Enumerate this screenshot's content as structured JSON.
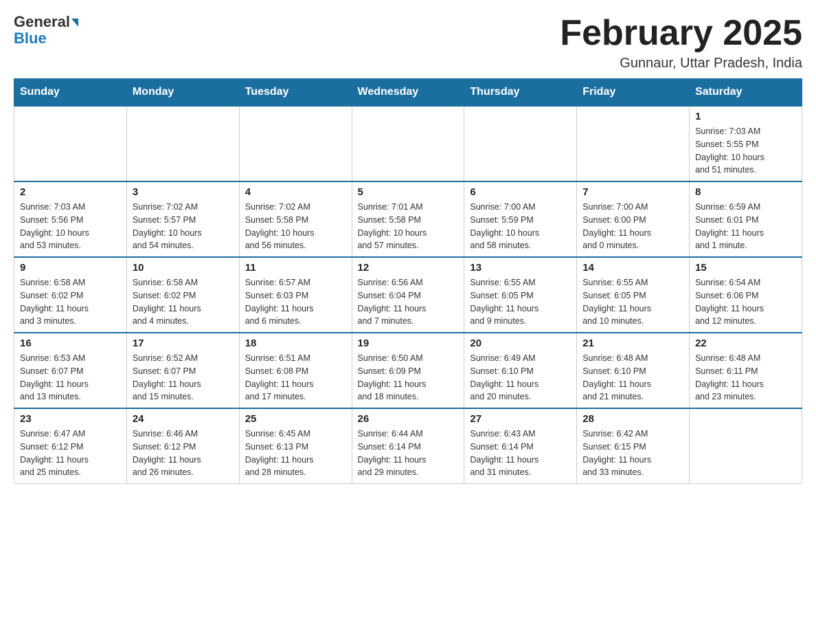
{
  "header": {
    "logo_general": "General",
    "logo_blue": "Blue",
    "month_title": "February 2025",
    "location": "Gunnaur, Uttar Pradesh, India"
  },
  "weekdays": [
    "Sunday",
    "Monday",
    "Tuesday",
    "Wednesday",
    "Thursday",
    "Friday",
    "Saturday"
  ],
  "weeks": [
    [
      {
        "day": "",
        "info": ""
      },
      {
        "day": "",
        "info": ""
      },
      {
        "day": "",
        "info": ""
      },
      {
        "day": "",
        "info": ""
      },
      {
        "day": "",
        "info": ""
      },
      {
        "day": "",
        "info": ""
      },
      {
        "day": "1",
        "info": "Sunrise: 7:03 AM\nSunset: 5:55 PM\nDaylight: 10 hours\nand 51 minutes."
      }
    ],
    [
      {
        "day": "2",
        "info": "Sunrise: 7:03 AM\nSunset: 5:56 PM\nDaylight: 10 hours\nand 53 minutes."
      },
      {
        "day": "3",
        "info": "Sunrise: 7:02 AM\nSunset: 5:57 PM\nDaylight: 10 hours\nand 54 minutes."
      },
      {
        "day": "4",
        "info": "Sunrise: 7:02 AM\nSunset: 5:58 PM\nDaylight: 10 hours\nand 56 minutes."
      },
      {
        "day": "5",
        "info": "Sunrise: 7:01 AM\nSunset: 5:58 PM\nDaylight: 10 hours\nand 57 minutes."
      },
      {
        "day": "6",
        "info": "Sunrise: 7:00 AM\nSunset: 5:59 PM\nDaylight: 10 hours\nand 58 minutes."
      },
      {
        "day": "7",
        "info": "Sunrise: 7:00 AM\nSunset: 6:00 PM\nDaylight: 11 hours\nand 0 minutes."
      },
      {
        "day": "8",
        "info": "Sunrise: 6:59 AM\nSunset: 6:01 PM\nDaylight: 11 hours\nand 1 minute."
      }
    ],
    [
      {
        "day": "9",
        "info": "Sunrise: 6:58 AM\nSunset: 6:02 PM\nDaylight: 11 hours\nand 3 minutes."
      },
      {
        "day": "10",
        "info": "Sunrise: 6:58 AM\nSunset: 6:02 PM\nDaylight: 11 hours\nand 4 minutes."
      },
      {
        "day": "11",
        "info": "Sunrise: 6:57 AM\nSunset: 6:03 PM\nDaylight: 11 hours\nand 6 minutes."
      },
      {
        "day": "12",
        "info": "Sunrise: 6:56 AM\nSunset: 6:04 PM\nDaylight: 11 hours\nand 7 minutes."
      },
      {
        "day": "13",
        "info": "Sunrise: 6:55 AM\nSunset: 6:05 PM\nDaylight: 11 hours\nand 9 minutes."
      },
      {
        "day": "14",
        "info": "Sunrise: 6:55 AM\nSunset: 6:05 PM\nDaylight: 11 hours\nand 10 minutes."
      },
      {
        "day": "15",
        "info": "Sunrise: 6:54 AM\nSunset: 6:06 PM\nDaylight: 11 hours\nand 12 minutes."
      }
    ],
    [
      {
        "day": "16",
        "info": "Sunrise: 6:53 AM\nSunset: 6:07 PM\nDaylight: 11 hours\nand 13 minutes."
      },
      {
        "day": "17",
        "info": "Sunrise: 6:52 AM\nSunset: 6:07 PM\nDaylight: 11 hours\nand 15 minutes."
      },
      {
        "day": "18",
        "info": "Sunrise: 6:51 AM\nSunset: 6:08 PM\nDaylight: 11 hours\nand 17 minutes."
      },
      {
        "day": "19",
        "info": "Sunrise: 6:50 AM\nSunset: 6:09 PM\nDaylight: 11 hours\nand 18 minutes."
      },
      {
        "day": "20",
        "info": "Sunrise: 6:49 AM\nSunset: 6:10 PM\nDaylight: 11 hours\nand 20 minutes."
      },
      {
        "day": "21",
        "info": "Sunrise: 6:48 AM\nSunset: 6:10 PM\nDaylight: 11 hours\nand 21 minutes."
      },
      {
        "day": "22",
        "info": "Sunrise: 6:48 AM\nSunset: 6:11 PM\nDaylight: 11 hours\nand 23 minutes."
      }
    ],
    [
      {
        "day": "23",
        "info": "Sunrise: 6:47 AM\nSunset: 6:12 PM\nDaylight: 11 hours\nand 25 minutes."
      },
      {
        "day": "24",
        "info": "Sunrise: 6:46 AM\nSunset: 6:12 PM\nDaylight: 11 hours\nand 26 minutes."
      },
      {
        "day": "25",
        "info": "Sunrise: 6:45 AM\nSunset: 6:13 PM\nDaylight: 11 hours\nand 28 minutes."
      },
      {
        "day": "26",
        "info": "Sunrise: 6:44 AM\nSunset: 6:14 PM\nDaylight: 11 hours\nand 29 minutes."
      },
      {
        "day": "27",
        "info": "Sunrise: 6:43 AM\nSunset: 6:14 PM\nDaylight: 11 hours\nand 31 minutes."
      },
      {
        "day": "28",
        "info": "Sunrise: 6:42 AM\nSunset: 6:15 PM\nDaylight: 11 hours\nand 33 minutes."
      },
      {
        "day": "",
        "info": ""
      }
    ]
  ]
}
